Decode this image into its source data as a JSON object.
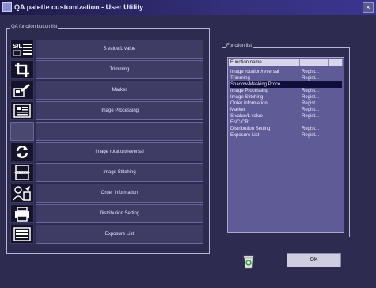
{
  "window": {
    "title": "QA palette customization - User Utility",
    "close_label": "×"
  },
  "qa_group": {
    "label": "QA function button list",
    "buttons": [
      {
        "label": "S value/L value",
        "icon": "sl-value-icon"
      },
      {
        "label": "Trimming",
        "icon": "crop-icon"
      },
      {
        "label": "Marker",
        "icon": "marker-icon"
      },
      {
        "label": "Image Processing",
        "icon": "image-processing-icon"
      },
      {
        "label": "",
        "icon": ""
      },
      {
        "label": "Image rotation/reversal",
        "icon": "rotate-icon"
      },
      {
        "label": "Image Stitching",
        "icon": "stitch-icon"
      },
      {
        "label": "Order information",
        "icon": "order-info-icon"
      },
      {
        "label": "Distribution Setting",
        "icon": "distribution-icon"
      },
      {
        "label": "Exposure List",
        "icon": "exposure-list-icon"
      }
    ]
  },
  "function_list": {
    "label": "Function list",
    "header": {
      "col1": "Function name",
      "col2": "",
      "col3": ""
    },
    "rows": [
      {
        "name": "Image rotation/reversal",
        "status": "Regist..."
      },
      {
        "name": "Trimming",
        "status": "Regist..."
      },
      {
        "name": "Shadow-Masking Proce...",
        "status": ""
      },
      {
        "name": "Image Processing",
        "status": "Regist..."
      },
      {
        "name": "Image Stitching",
        "status": "Regist..."
      },
      {
        "name": "Order information",
        "status": "Regist..."
      },
      {
        "name": "Marker",
        "status": "Regist..."
      },
      {
        "name": "S value/L value",
        "status": "Regist..."
      },
      {
        "name": "FNC/CR/",
        "status": ""
      },
      {
        "name": "Distribution Setting",
        "status": "Regist..."
      },
      {
        "name": "Exposure List",
        "status": "Regist..."
      }
    ],
    "selected_index": 2
  },
  "ok_button": {
    "label": "OK"
  },
  "trash": {
    "icon": "trash-icon"
  }
}
